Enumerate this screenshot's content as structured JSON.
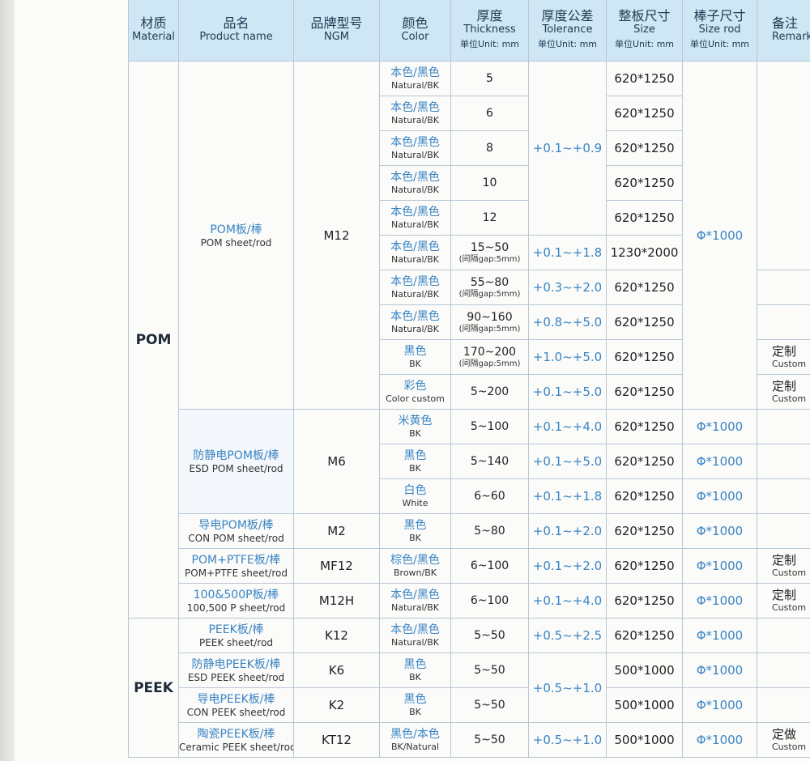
{
  "headers": {
    "material": {
      "zh": "材质",
      "en": "Material"
    },
    "product": {
      "zh": "品名",
      "en": "Product name"
    },
    "grade": {
      "zh": "品牌型号",
      "en": "NGM"
    },
    "color": {
      "zh": "颜色",
      "en": "Color"
    },
    "thickness": {
      "zh": "厚度",
      "en": "Thickness",
      "unit": "单位Unit: mm"
    },
    "tolerance": {
      "zh": "厚度公差",
      "en": "Tolerance",
      "unit": "单位Unit: mm"
    },
    "size": {
      "zh": "整板尺寸",
      "en": "Size",
      "unit": "单位Unit: mm"
    },
    "rod": {
      "zh": "棒子尺寸",
      "en": "Size rod",
      "unit": "单位Unit: mm"
    },
    "remark": {
      "zh": "备注",
      "en": "Remark"
    }
  },
  "groups": {
    "pom": "POM",
    "peek": "PEEK"
  },
  "products": {
    "pom": {
      "zh": "POM板/棒",
      "en": "POM sheet/rod",
      "grade": "M12"
    },
    "esd_pom": {
      "zh": "防静电POM板/棒",
      "en": "ESD POM sheet/rod",
      "grade": "M6"
    },
    "con_pom": {
      "zh": "导电POM板/棒",
      "en": "CON POM sheet/rod",
      "grade": "M2"
    },
    "pom_ptfe": {
      "zh": "POM+PTFE板/棒",
      "en": "POM+PTFE sheet/rod",
      "grade": "MF12"
    },
    "p100": {
      "zh": "100&500P板/棒",
      "en": "100,500 P sheet/rod",
      "grade": "M12H"
    },
    "peek": {
      "zh": "PEEK板/棒",
      "en": "PEEK sheet/rod",
      "grade": "K12"
    },
    "esd_peek": {
      "zh": "防静电PEEK板/棒",
      "en": "ESD PEEK sheet/rod",
      "grade": "K6"
    },
    "con_peek": {
      "zh": "导电PEEK板/棒",
      "en": "CON PEEK sheet/rod",
      "grade": "K2"
    },
    "cer_peek": {
      "zh": "陶瓷PEEK板/棒",
      "en": "Ceramic PEEK sheet/rod",
      "grade": "KT12"
    }
  },
  "rows": [
    {
      "color_zh": "本色/黑色",
      "color_en": "Natural/BK",
      "thick": "5",
      "gap": "",
      "size": "620*1250"
    },
    {
      "color_zh": "本色/黑色",
      "color_en": "Natural/BK",
      "thick": "6",
      "gap": "",
      "size": "620*1250"
    },
    {
      "color_zh": "本色/黑色",
      "color_en": "Natural/BK",
      "thick": "8",
      "gap": "",
      "size": "620*1250"
    },
    {
      "color_zh": "本色/黑色",
      "color_en": "Natural/BK",
      "thick": "10",
      "gap": "",
      "size": "620*1250"
    },
    {
      "color_zh": "本色/黑色",
      "color_en": "Natural/BK",
      "thick": "12",
      "gap": "",
      "size": "620*1250"
    },
    {
      "color_zh": "本色/黑色",
      "color_en": "Natural/BK",
      "thick": "15~50",
      "gap": "(间隔gap:5mm)",
      "size": "1230*2000",
      "tol": "+0.1~+1.8"
    },
    {
      "color_zh": "本色/黑色",
      "color_en": "Natural/BK",
      "thick": "55~80",
      "gap": "(间隔gap:5mm)",
      "size": "620*1250",
      "tol": "+0.3~+2.0"
    },
    {
      "color_zh": "本色/黑色",
      "color_en": "Natural/BK",
      "thick": "90~160",
      "gap": "(间隔gap:5mm)",
      "size": "620*1250",
      "tol": "+0.8~+5.0"
    },
    {
      "color_zh": "黑色",
      "color_en": "BK",
      "thick": "170~200",
      "gap": "(间隔gap:5mm)",
      "size": "620*1250",
      "tol": "+1.0~+5.0",
      "remark_zh": "定制",
      "remark_en": "Custom"
    },
    {
      "color_zh": "彩色",
      "color_en": "Color custom",
      "thick": "5~200",
      "gap": "",
      "size": "620*1250",
      "tol": "+0.1~+5.0",
      "remark_zh": "定制",
      "remark_en": "Custom"
    },
    {
      "color_zh": "米黄色",
      "color_en": "BK",
      "thick": "5~100",
      "gap": "",
      "size": "620*1250",
      "tol": "+0.1~+4.0",
      "rod": "Φ*1000"
    },
    {
      "color_zh": "黑色",
      "color_en": "BK",
      "thick": "5~140",
      "gap": "",
      "size": "620*1250",
      "tol": "+0.1~+5.0",
      "rod": "Φ*1000"
    },
    {
      "color_zh": "白色",
      "color_en": "White",
      "thick": "6~60",
      "gap": "",
      "size": "620*1250",
      "tol": "+0.1~+1.8",
      "rod": "Φ*1000"
    },
    {
      "color_zh": "黑色",
      "color_en": "BK",
      "thick": "5~80",
      "gap": "",
      "size": "620*1250",
      "tol": "+0.1~+2.0",
      "rod": "Φ*1000"
    },
    {
      "color_zh": "棕色/黑色",
      "color_en": "Brown/BK",
      "thick": "6~100",
      "gap": "",
      "size": "620*1250",
      "tol": "+0.1~+2.0",
      "rod": "Φ*1000",
      "remark_zh": "定制",
      "remark_en": "Custom"
    },
    {
      "color_zh": "本色/黑色",
      "color_en": "Natural/BK",
      "thick": "6~100",
      "gap": "",
      "size": "620*1250",
      "tol": "+0.1~+4.0",
      "rod": "Φ*1000",
      "remark_zh": "定制",
      "remark_en": "Custom"
    },
    {
      "color_zh": "本色/黑色",
      "color_en": "Natural/BK",
      "thick": "5~50",
      "gap": "",
      "size": "620*1250",
      "tol": "+0.5~+2.5",
      "rod": "Φ*1000"
    },
    {
      "color_zh": "黑色",
      "color_en": "BK",
      "thick": "5~50",
      "gap": "",
      "size": "500*1000",
      "rod": "Φ*1000"
    },
    {
      "color_zh": "黑色",
      "color_en": "BK",
      "thick": "5~50",
      "gap": "",
      "size": "500*1000",
      "rod": "Φ*1000"
    },
    {
      "color_zh": "黑色/本色",
      "color_en": "BK/Natural",
      "thick": "5~50",
      "gap": "",
      "size": "500*1000",
      "tol": "+0.5~+1.0",
      "rod": "Φ*1000",
      "remark_zh": "定做",
      "remark_en": "Custom"
    }
  ],
  "merged": {
    "tol_pom_1_5": "+0.1~+0.9",
    "rod_pom_1_10": "Φ*1000",
    "tol_peek_2_3": "+0.5~+1.0"
  }
}
